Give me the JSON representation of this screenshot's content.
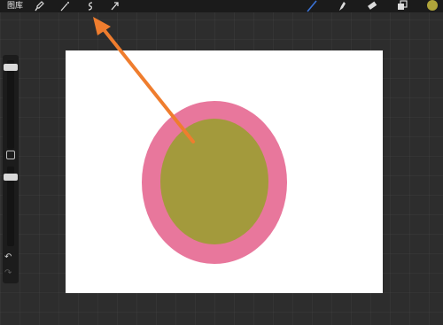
{
  "topbar": {
    "gallery_label": "图库",
    "tools_left": [
      {
        "icon": "wrench-icon"
      },
      {
        "icon": "magic-wand-icon"
      },
      {
        "icon": "selection-icon"
      },
      {
        "icon": "transform-arrow-icon"
      }
    ],
    "tools_right": [
      {
        "icon": "brush-icon"
      },
      {
        "icon": "smudge-icon"
      },
      {
        "icon": "eraser-icon"
      },
      {
        "icon": "layers-icon"
      }
    ],
    "current_color": "#b0a43a"
  },
  "sidebar": {
    "undo_icon": "↶",
    "redo_icon": "↷"
  },
  "canvas": {
    "background": "#ffffff",
    "outer_color": "#e8779c",
    "inner_color": "#a39a3c"
  },
  "annotation": {
    "arrow_color": "#ef7d2e"
  }
}
